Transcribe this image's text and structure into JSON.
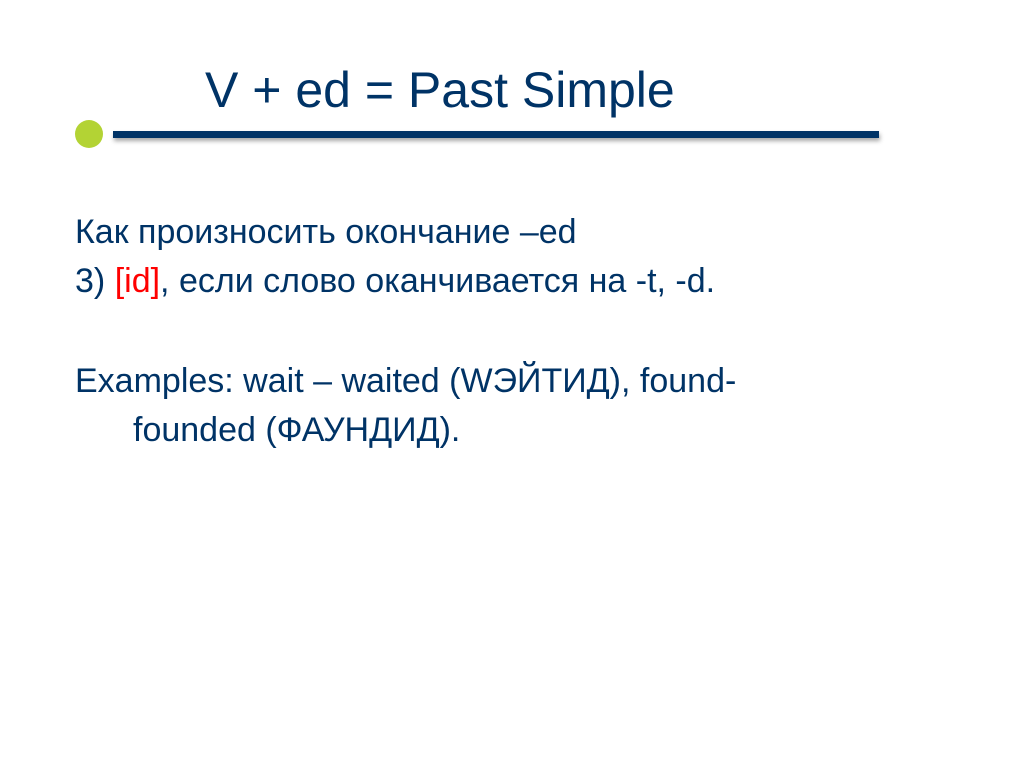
{
  "title": "V + ed = Past Simple",
  "line1": "Как произносить окончание –ed",
  "line2_prefix": "3) ",
  "line2_highlight": "[id]",
  "line2_suffix": ", если слово оканчивается на -t, -d.",
  "example_line1": "Examples: wait – waited (WЭЙТИД), found-",
  "example_line2": "founded (ФАУНДИД)."
}
